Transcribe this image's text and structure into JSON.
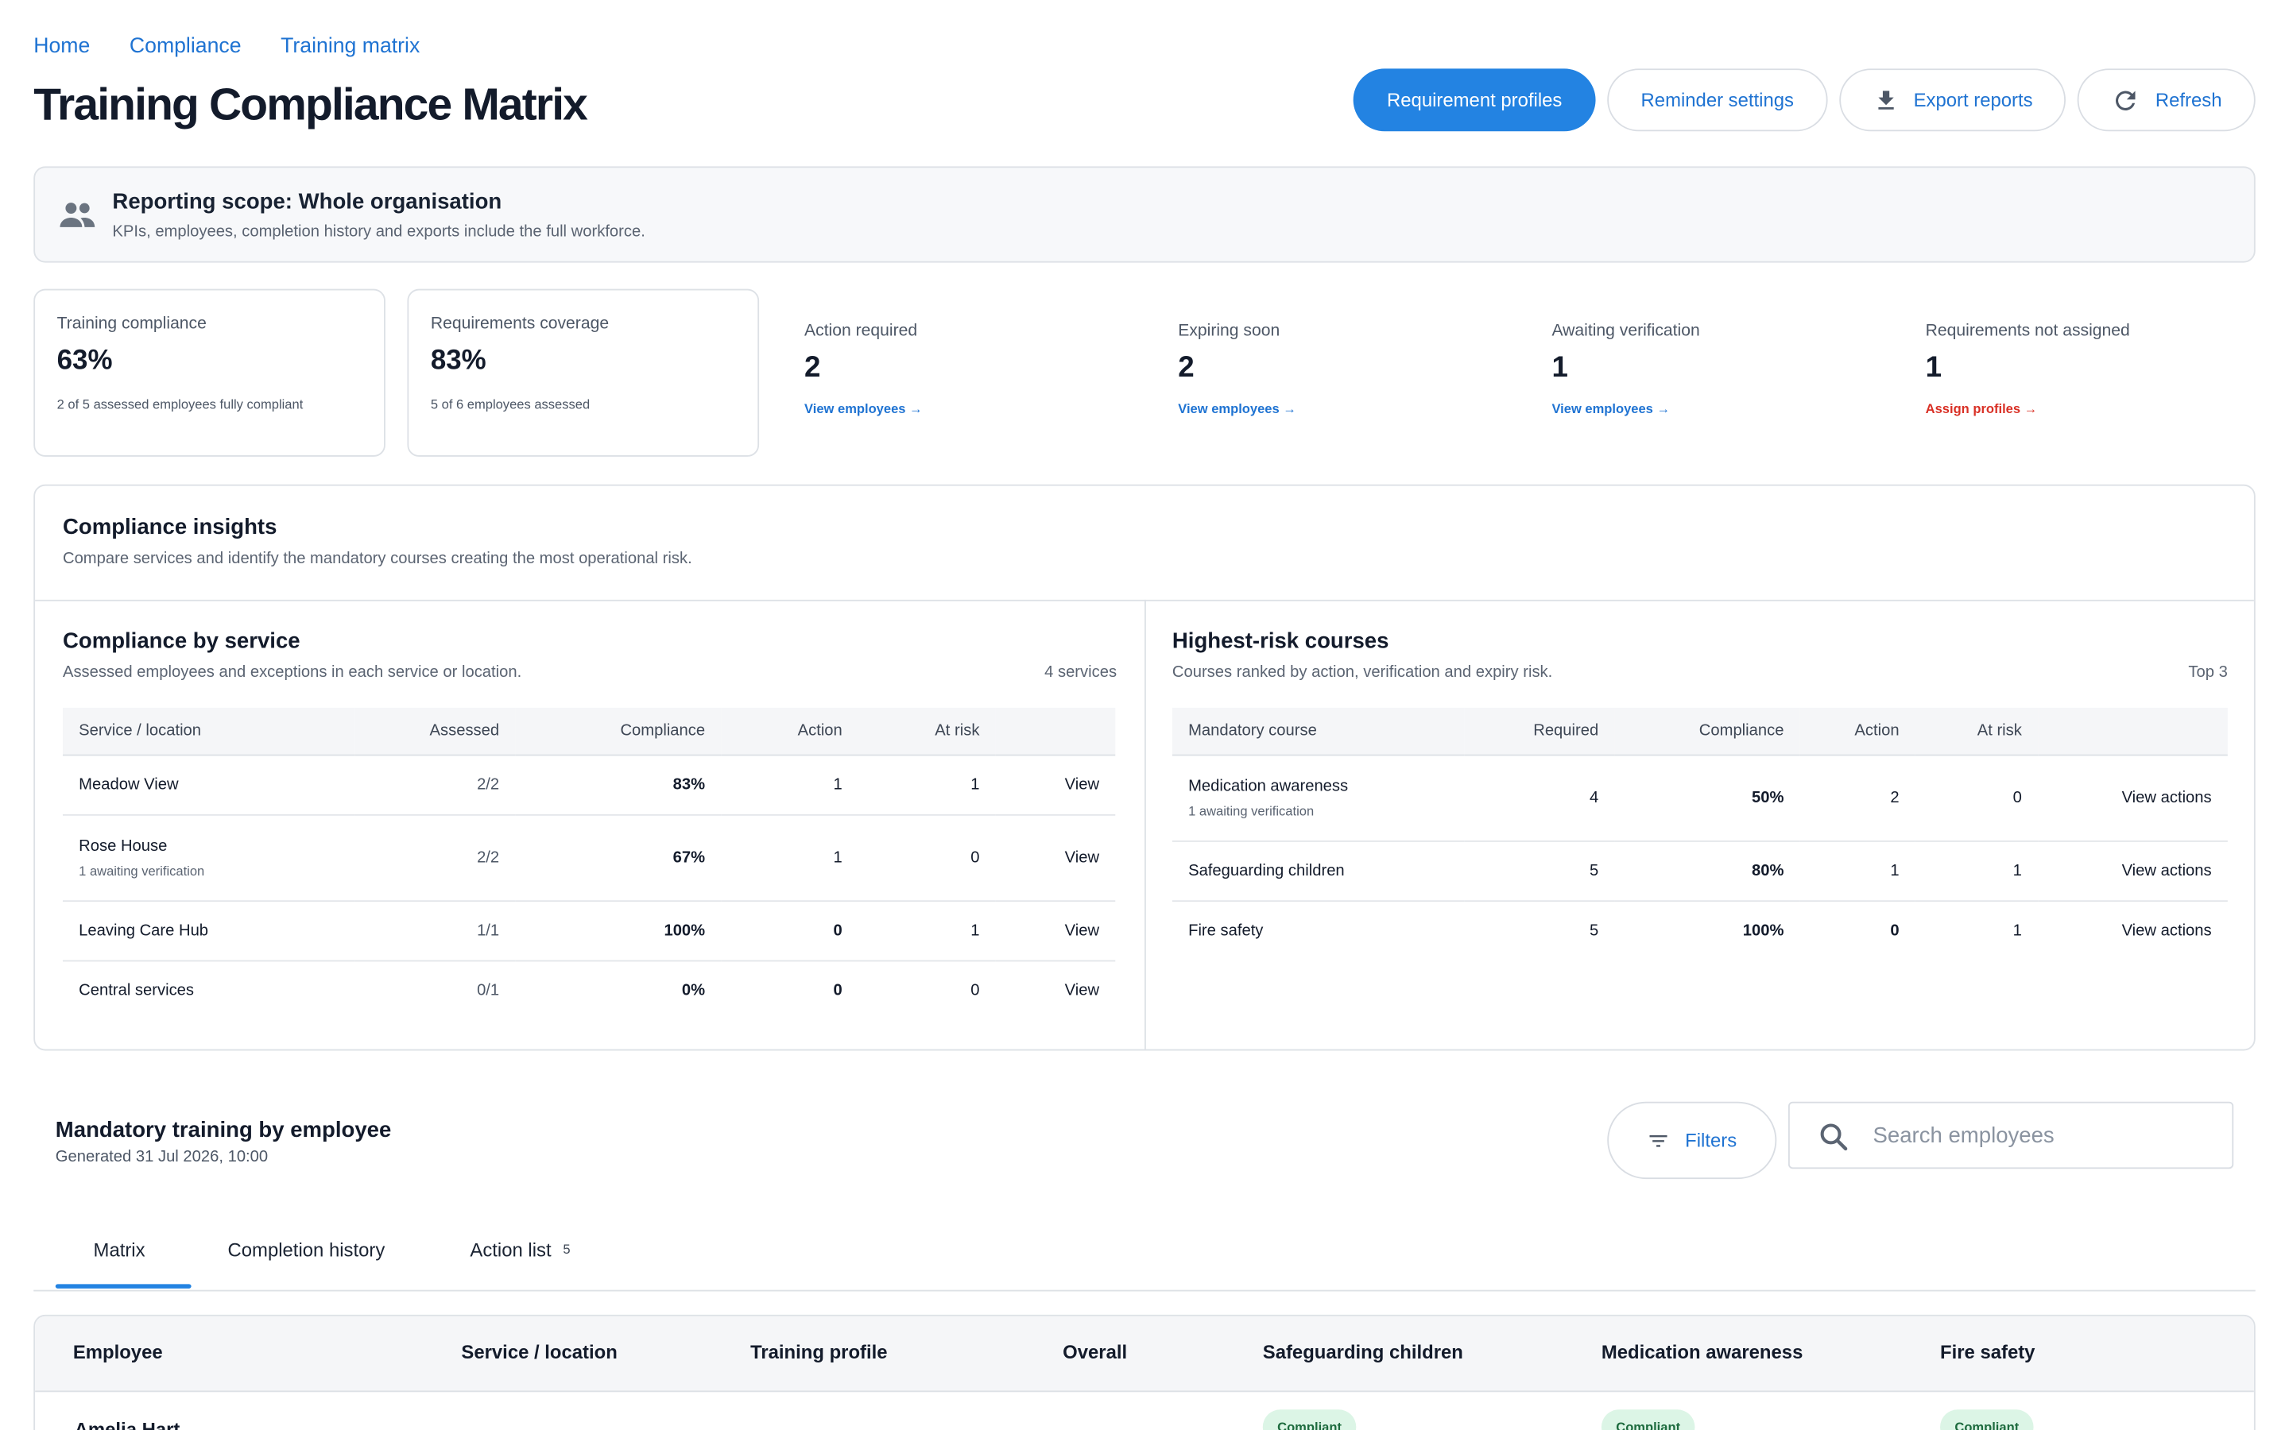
{
  "breadcrumb": [
    "Home",
    "Compliance",
    "Training matrix"
  ],
  "page_title": "Training Compliance Matrix",
  "actions": {
    "requirement_profiles": "Requirement profiles",
    "reminder_settings": "Reminder settings",
    "export_reports": "Export reports",
    "refresh": "Refresh"
  },
  "scope": {
    "title": "Reporting scope: Whole organisation",
    "subtitle": "KPIs, employees, completion history and exports include the full workforce."
  },
  "kpis": {
    "training_compliance": {
      "label": "Training compliance",
      "value": "63%",
      "sub": "2 of 5 assessed employees fully compliant"
    },
    "requirements_coverage": {
      "label": "Requirements coverage",
      "value": "83%",
      "sub": "5 of 6 employees assessed"
    },
    "action_required": {
      "label": "Action required",
      "value": "2",
      "link": "View employees →"
    },
    "expiring_soon": {
      "label": "Expiring soon",
      "value": "2",
      "link": "View employees →"
    },
    "awaiting_verification": {
      "label": "Awaiting verification",
      "value": "1",
      "link": "View employees →"
    },
    "not_assigned": {
      "label": "Requirements not assigned",
      "value": "1",
      "link": "Assign profiles →"
    }
  },
  "insights": {
    "title": "Compliance insights",
    "subtitle": "Compare services and identify the mandatory courses creating the most operational risk.",
    "by_service": {
      "title": "Compliance by service",
      "subtitle": "Assessed employees and exceptions in each service or location.",
      "count": "4 services",
      "headers": [
        "Service / location",
        "Assessed",
        "Compliance",
        "Action",
        "At risk"
      ],
      "rows": [
        {
          "name": "Meadow View",
          "note": "",
          "assessed": "2/2",
          "compliance": "83%",
          "action": "1",
          "at_risk": "1",
          "link": "View"
        },
        {
          "name": "Rose House",
          "note": "1 awaiting verification",
          "assessed": "2/2",
          "compliance": "67%",
          "action": "1",
          "at_risk": "0",
          "link": "View"
        },
        {
          "name": "Leaving Care Hub",
          "note": "",
          "assessed": "1/1",
          "compliance": "100%",
          "action": "0",
          "at_risk": "1",
          "link": "View"
        },
        {
          "name": "Central services",
          "note": "",
          "assessed": "0/1",
          "compliance": "0%",
          "action": "0",
          "at_risk": "0",
          "link": "View"
        }
      ]
    },
    "risk_courses": {
      "title": "Highest-risk courses",
      "subtitle": "Courses ranked by action, verification and expiry risk.",
      "count": "Top 3",
      "headers": [
        "Mandatory course",
        "Required",
        "Compliance",
        "Action",
        "At risk"
      ],
      "rows": [
        {
          "name": "Medication awareness",
          "note": "1 awaiting verification",
          "required": "4",
          "compliance": "50%",
          "action": "2",
          "at_risk": "0",
          "link": "View actions"
        },
        {
          "name": "Safeguarding children",
          "note": "",
          "required": "5",
          "compliance": "80%",
          "action": "1",
          "at_risk": "1",
          "link": "View actions"
        },
        {
          "name": "Fire safety",
          "note": "",
          "required": "5",
          "compliance": "100%",
          "action": "0",
          "at_risk": "1",
          "link": "View actions"
        }
      ]
    }
  },
  "employees": {
    "title": "Mandatory training by employee",
    "generated": "Generated 31 Jul 2026, 10:00",
    "filters_label": "Filters",
    "search_placeholder": "Search employees",
    "tabs": [
      {
        "label": "Matrix",
        "badge": ""
      },
      {
        "label": "Completion history",
        "badge": ""
      },
      {
        "label": "Action list",
        "badge": "5"
      }
    ],
    "matrix_headers": [
      "Employee",
      "Service / location",
      "Training profile",
      "Overall",
      "Safeguarding children",
      "Medication awareness",
      "Fire safety"
    ],
    "rows": [
      {
        "name": "Amelia Hart",
        "statuses": [
          "Compliant",
          "Compliant",
          "Compliant"
        ]
      }
    ]
  },
  "colors": {
    "accent": "#2383e2",
    "danger": "#d93025",
    "success_bg": "#dcf5e6"
  }
}
